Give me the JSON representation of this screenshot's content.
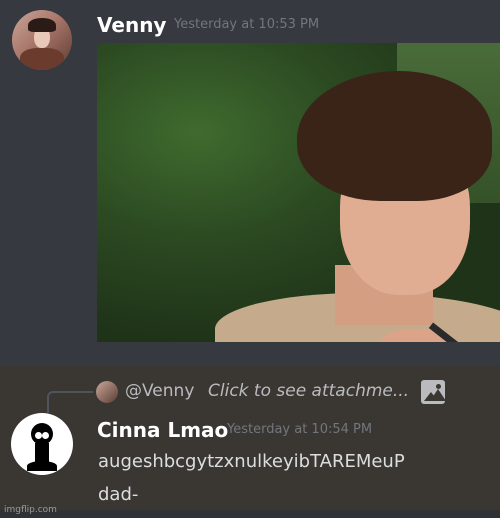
{
  "message1": {
    "username": "Venny",
    "timestamp": "Yesterday at 10:53 PM",
    "attachment_icon": "image-attachment"
  },
  "message2": {
    "reply": {
      "mention": "@Venny",
      "text": "Click to see attachme...",
      "icon": "image-icon"
    },
    "username": "Cinna Lmao",
    "timestamp": "Yesterday at 10:54 PM",
    "lines": [
      "augeshbcgytzxnulkeyibTAREMeuP",
      "dad-"
    ]
  },
  "watermark": "imgflip.com"
}
